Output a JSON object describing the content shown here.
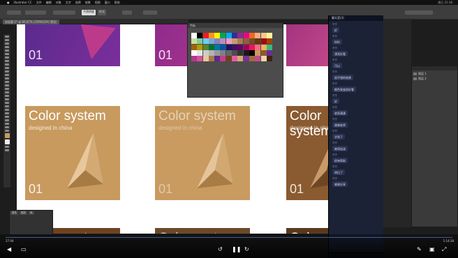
{
  "menubar": {
    "items": [
      "Illustrator CC",
      "文件",
      "编辑",
      "对象",
      "文字",
      "选择",
      "效果",
      "视图",
      "窗口",
      "帮助"
    ],
    "right_text": "周日 22:38"
  },
  "ctrlbar": {
    "btn1": "不透明度",
    "btn2": "样式"
  },
  "doctab": {
    "label": "未标题-1* @ 66.67% (CMYK/GPU 预览)"
  },
  "cards": {
    "title": "Color system",
    "subtitle": "designed in china",
    "number": "01"
  },
  "swatch": {
    "title": "色板"
  },
  "chat": {
    "title": "聊天室(3)",
    "messages": [
      {
        "user": "学员",
        "text": "好"
      },
      {
        "user": "学员",
        "text": "666"
      },
      {
        "user": "学员",
        "text": "漂亮好看"
      },
      {
        "user": "学员",
        "text": "可以"
      },
      {
        "user": "学员",
        "text": "很不错的效果"
      },
      {
        "user": "学员",
        "text": "颜色渐变很好看"
      },
      {
        "user": "学员",
        "text": "好"
      },
      {
        "user": "学员",
        "text": "收获满满"
      },
      {
        "user": "学员",
        "text": "谢谢老师"
      },
      {
        "user": "学员",
        "text": "学到了"
      },
      {
        "user": "学员",
        "text": "继续加油"
      },
      {
        "user": "学员",
        "text": "很有帮助"
      },
      {
        "user": "学员",
        "text": "明白了"
      },
      {
        "user": "学员",
        "text": "感谢分享"
      }
    ]
  },
  "layers": {
    "rows": [
      "图层 1",
      "图层 2"
    ]
  },
  "properties": {
    "tabs": [
      "属性",
      "图层",
      "库"
    ]
  },
  "video": {
    "current": "27:04",
    "total": "1:14:38"
  },
  "colors": {
    "purple": "#6a2c98",
    "magenta": "#b5388a",
    "gold": "#c89a60",
    "brown": "#8b5a2b"
  }
}
